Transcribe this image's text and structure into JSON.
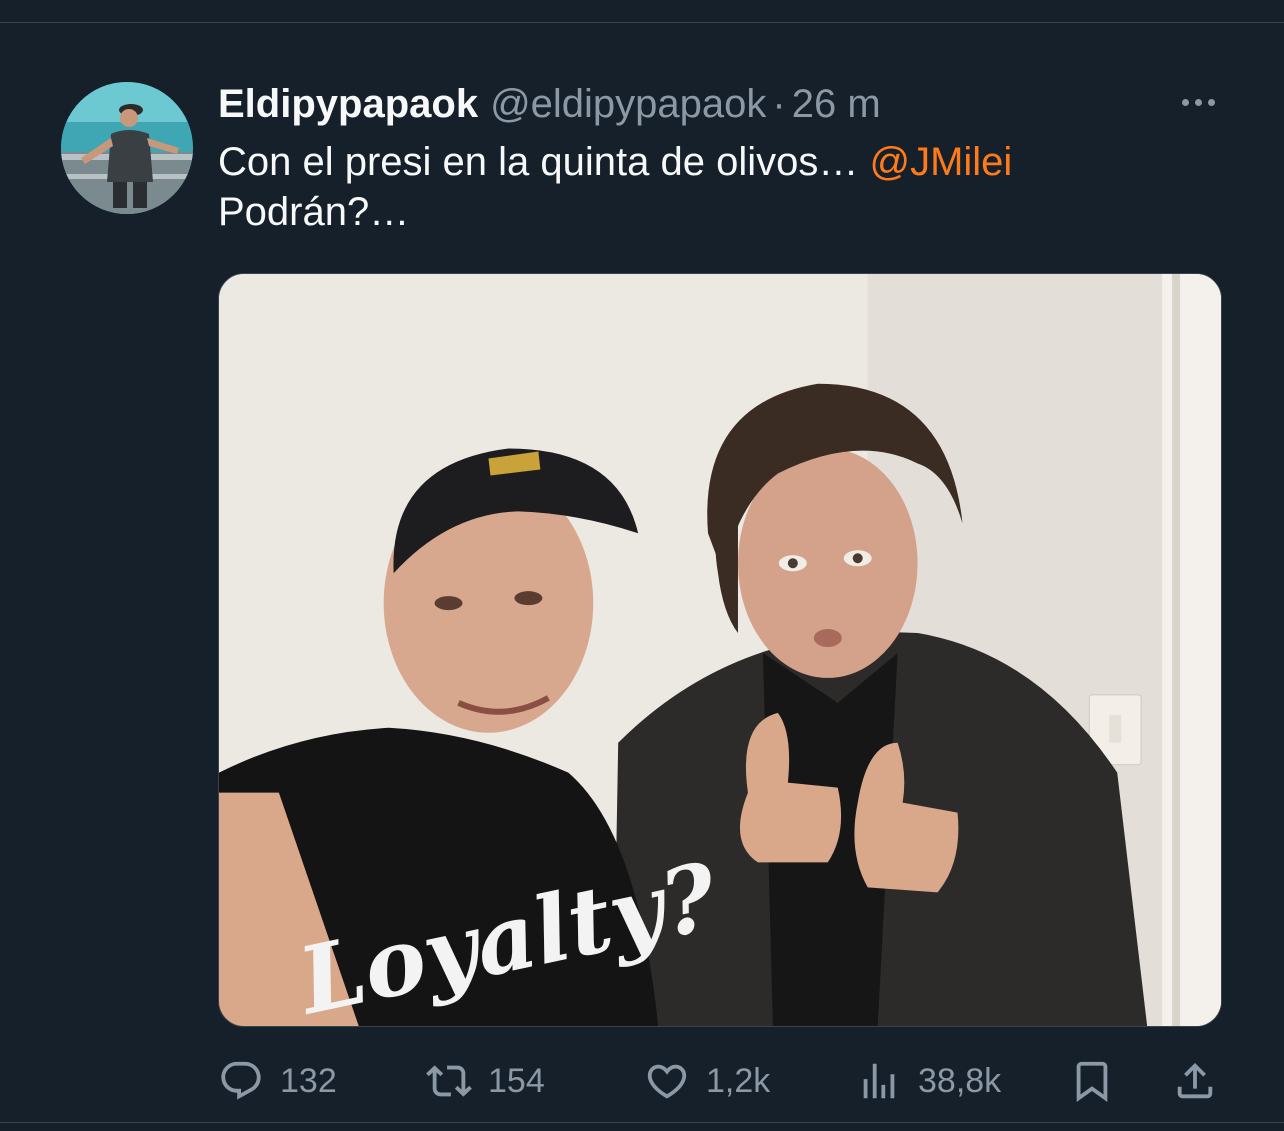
{
  "tweet": {
    "display_name": "Eldipypapaok",
    "handle": "@eldipypapaok",
    "separator": "·",
    "time": "26 m",
    "text_line1": "Con el presi en la quinta de olivos… ",
    "mention": "@JMilei",
    "text_line2": "Podrán?…",
    "media": {
      "shirt_text": "Loyalty?"
    }
  },
  "actions": {
    "replies": "132",
    "retweets": "154",
    "likes": "1,2k",
    "views": "38,8k"
  },
  "icons": {
    "more": "more-horizontal-icon",
    "reply": "reply-bubble-icon",
    "retweet": "retweet-icon",
    "like": "heart-icon",
    "views": "analytics-bars-icon",
    "bookmark": "bookmark-icon",
    "share": "share-upload-icon"
  },
  "colors": {
    "background": "#15202b",
    "mention": "#ff7a1a",
    "secondary_text": "#8b98a5"
  }
}
